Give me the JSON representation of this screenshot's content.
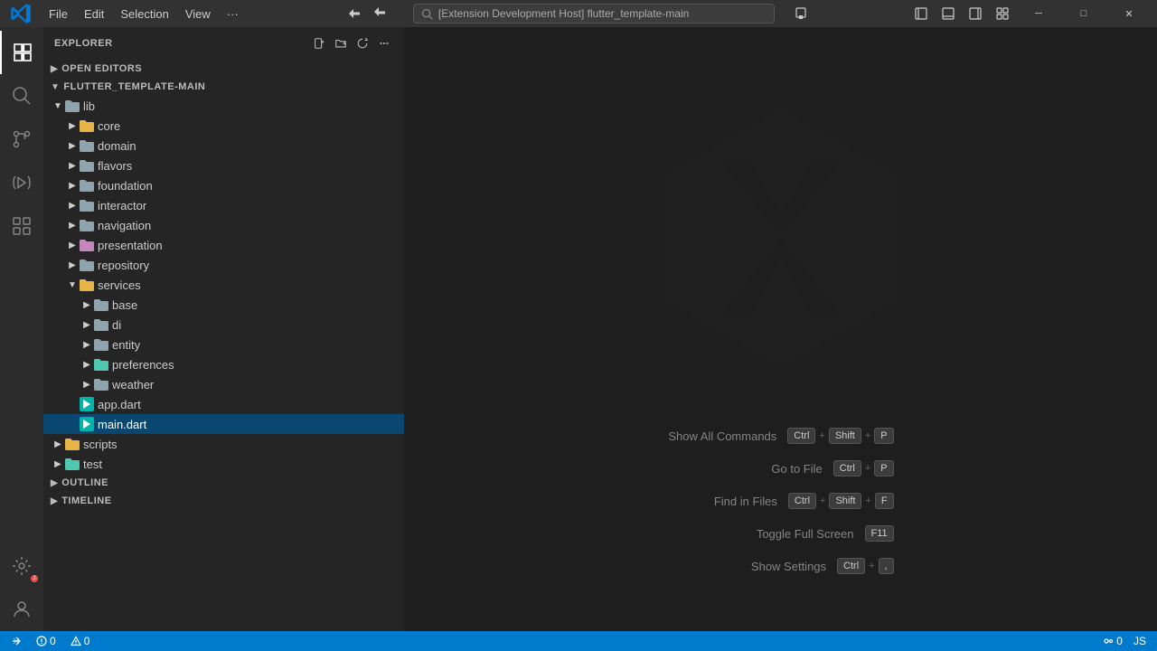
{
  "titlebar": {
    "logo_label": "VS Code",
    "menu_items": [
      "File",
      "Edit",
      "Selection",
      "View"
    ],
    "more_label": "···",
    "search_text": "[Extension Development Host] flutter_template-main",
    "nav_back": "←",
    "nav_forward": "→",
    "layout_btn1": "⬛",
    "layout_btn2": "⬛",
    "layout_btn3": "⬛",
    "layout_btn4": "⬛",
    "minimize": "─",
    "maximize": "□",
    "close": "✕"
  },
  "sidebar": {
    "header_label": "EXPLORER",
    "open_editors_label": "OPEN EDITORS",
    "project_label": "FLUTTER_TEMPLATE-MAIN",
    "outline_label": "OUTLINE",
    "timeline_label": "TIMELINE"
  },
  "tree": {
    "lib": {
      "label": "lib",
      "children": [
        {
          "label": "core",
          "type": "folder-colored",
          "expanded": false
        },
        {
          "label": "domain",
          "type": "folder-default",
          "expanded": false
        },
        {
          "label": "flavors",
          "type": "folder-default",
          "expanded": false
        },
        {
          "label": "foundation",
          "type": "folder-default",
          "expanded": false
        },
        {
          "label": "interactor",
          "type": "folder-default",
          "expanded": false
        },
        {
          "label": "navigation",
          "type": "folder-default",
          "expanded": false
        },
        {
          "label": "presentation",
          "type": "folder-colored",
          "expanded": false
        },
        {
          "label": "repository",
          "type": "folder-default",
          "expanded": false
        },
        {
          "label": "services",
          "type": "folder-colored",
          "expanded": true,
          "children": [
            {
              "label": "base",
              "type": "folder-default",
              "expanded": false
            },
            {
              "label": "di",
              "type": "folder-default",
              "expanded": false
            },
            {
              "label": "entity",
              "type": "folder-default",
              "expanded": false
            },
            {
              "label": "preferences",
              "type": "folder-colored",
              "expanded": false
            },
            {
              "label": "weather",
              "type": "folder-default",
              "expanded": false
            }
          ]
        },
        {
          "label": "app.dart",
          "type": "file-dart"
        },
        {
          "label": "main.dart",
          "type": "file-dart",
          "selected": true
        }
      ]
    },
    "scripts": {
      "label": "scripts",
      "type": "folder-colored"
    },
    "test": {
      "label": "test",
      "type": "folder-colored"
    }
  },
  "welcome": {
    "shortcuts": [
      {
        "label": "Show All Commands",
        "keys": [
          "Ctrl",
          "+",
          "Shift",
          "+",
          "P"
        ]
      },
      {
        "label": "Go to File",
        "keys": [
          "Ctrl",
          "+",
          "P"
        ]
      },
      {
        "label": "Find in Files",
        "keys": [
          "Ctrl",
          "+",
          "Shift",
          "+",
          "F"
        ]
      },
      {
        "label": "Toggle Full Screen",
        "keys": [
          "F11"
        ]
      },
      {
        "label": "Show Settings",
        "keys": [
          "Ctrl",
          "+",
          ","
        ]
      }
    ]
  },
  "statusbar": {
    "errors": "0",
    "warnings": "0",
    "remote": "0",
    "encoding": "JS"
  }
}
